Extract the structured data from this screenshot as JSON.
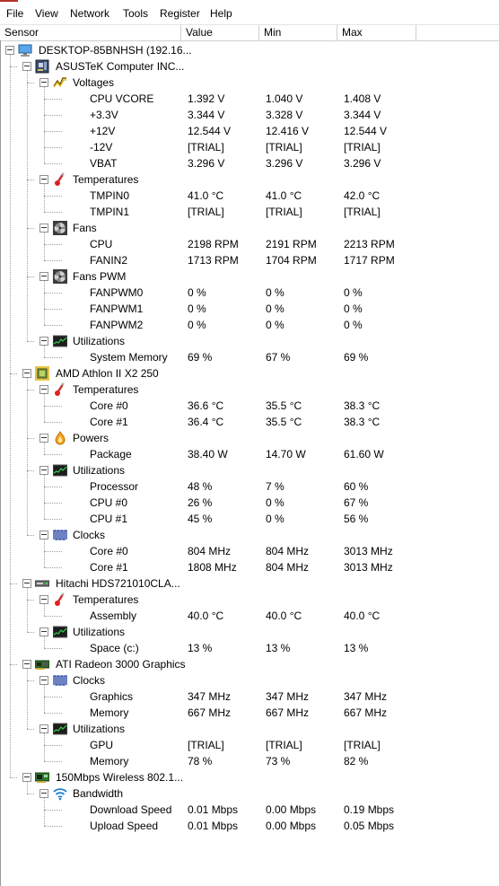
{
  "menu": [
    "File",
    "View",
    "Network",
    "Tools",
    "Register",
    "Help"
  ],
  "columns": {
    "sensor": "Sensor",
    "value": "Value",
    "min": "Min",
    "max": "Max"
  },
  "rows": [
    {
      "level": 0,
      "type": "computer",
      "label": "DESKTOP-85BNHSH (192.16...",
      "icon": "computer-icon"
    },
    {
      "level": 1,
      "type": "board",
      "label": "ASUSTeK Computer INC...",
      "icon": "motherboard-icon"
    },
    {
      "level": 2,
      "type": "group",
      "label": "Voltages",
      "icon": "voltage-icon"
    },
    {
      "level": 3,
      "label": "CPU VCORE",
      "value": "1.392 V",
      "min": "1.040 V",
      "max": "1.408 V"
    },
    {
      "level": 3,
      "label": "+3.3V",
      "value": "3.344 V",
      "min": "3.328 V",
      "max": "3.344 V"
    },
    {
      "level": 3,
      "label": "+12V",
      "value": "12.544 V",
      "min": "12.416 V",
      "max": "12.544 V"
    },
    {
      "level": 3,
      "label": "-12V",
      "value": "[TRIAL]",
      "min": "[TRIAL]",
      "max": "[TRIAL]"
    },
    {
      "level": 3,
      "label": "VBAT",
      "value": "3.296 V",
      "min": "3.296 V",
      "max": "3.296 V",
      "last": true
    },
    {
      "level": 2,
      "type": "group",
      "label": "Temperatures",
      "icon": "thermometer-icon"
    },
    {
      "level": 3,
      "label": "TMPIN0",
      "value": "41.0 °C",
      "min": "41.0 °C",
      "max": "42.0 °C"
    },
    {
      "level": 3,
      "label": "TMPIN1",
      "value": "[TRIAL]",
      "min": "[TRIAL]",
      "max": "[TRIAL]",
      "last": true
    },
    {
      "level": 2,
      "type": "group",
      "label": "Fans",
      "icon": "fan-icon"
    },
    {
      "level": 3,
      "label": "CPU",
      "value": "2198 RPM",
      "min": "2191 RPM",
      "max": "2213 RPM"
    },
    {
      "level": 3,
      "label": "FANIN2",
      "value": "1713 RPM",
      "min": "1704 RPM",
      "max": "1717 RPM",
      "last": true
    },
    {
      "level": 2,
      "type": "group",
      "label": "Fans PWM",
      "icon": "fan-icon"
    },
    {
      "level": 3,
      "label": "FANPWM0",
      "value": "0 %",
      "min": "0 %",
      "max": "0 %"
    },
    {
      "level": 3,
      "label": "FANPWM1",
      "value": "0 %",
      "min": "0 %",
      "max": "0 %"
    },
    {
      "level": 3,
      "label": "FANPWM2",
      "value": "0 %",
      "min": "0 %",
      "max": "0 %",
      "last": true
    },
    {
      "level": 2,
      "type": "group",
      "label": "Utilizations",
      "icon": "utilization-icon",
      "lastgroup": true
    },
    {
      "level": 3,
      "label": "System Memory",
      "value": "69 %",
      "min": "67 %",
      "max": "69 %",
      "last": true
    },
    {
      "level": 1,
      "type": "chip",
      "label": "AMD Athlon II X2 250",
      "icon": "cpu-chip-icon"
    },
    {
      "level": 2,
      "type": "group",
      "label": "Temperatures",
      "icon": "thermometer-icon"
    },
    {
      "level": 3,
      "label": "Core #0",
      "value": "36.6 °C",
      "min": "35.5 °C",
      "max": "38.3 °C"
    },
    {
      "level": 3,
      "label": "Core #1",
      "value": "36.4 °C",
      "min": "35.5 °C",
      "max": "38.3 °C",
      "last": true
    },
    {
      "level": 2,
      "type": "group",
      "label": "Powers",
      "icon": "power-icon"
    },
    {
      "level": 3,
      "label": "Package",
      "value": "38.40 W",
      "min": "14.70 W",
      "max": "61.60 W",
      "last": true
    },
    {
      "level": 2,
      "type": "group",
      "label": "Utilizations",
      "icon": "utilization-icon"
    },
    {
      "level": 3,
      "label": "Processor",
      "value": "48 %",
      "min": "7 %",
      "max": "60 %"
    },
    {
      "level": 3,
      "label": "CPU #0",
      "value": "26 %",
      "min": "0 %",
      "max": "67 %"
    },
    {
      "level": 3,
      "label": "CPU #1",
      "value": "45 %",
      "min": "0 %",
      "max": "56 %",
      "last": true
    },
    {
      "level": 2,
      "type": "group",
      "label": "Clocks",
      "icon": "clock-icon",
      "lastgroup": true
    },
    {
      "level": 3,
      "label": "Core #0",
      "value": "804 MHz",
      "min": "804 MHz",
      "max": "3013 MHz"
    },
    {
      "level": 3,
      "label": "Core #1",
      "value": "1808 MHz",
      "min": "804 MHz",
      "max": "3013 MHz",
      "last": true
    },
    {
      "level": 1,
      "type": "disk",
      "label": "Hitachi HDS721010CLA...",
      "icon": "hard-disk-icon"
    },
    {
      "level": 2,
      "type": "group",
      "label": "Temperatures",
      "icon": "thermometer-icon"
    },
    {
      "level": 3,
      "label": "Assembly",
      "value": "40.0 °C",
      "min": "40.0 °C",
      "max": "40.0 °C",
      "last": true
    },
    {
      "level": 2,
      "type": "group",
      "label": "Utilizations",
      "icon": "utilization-icon",
      "lastgroup": true
    },
    {
      "level": 3,
      "label": "Space (c:)",
      "value": "13 %",
      "min": "13 %",
      "max": "13 %",
      "last": true
    },
    {
      "level": 1,
      "type": "gpu",
      "label": "ATI Radeon 3000 Graphics",
      "icon": "graphics-card-icon"
    },
    {
      "level": 2,
      "type": "group",
      "label": "Clocks",
      "icon": "clock-icon"
    },
    {
      "level": 3,
      "label": "Graphics",
      "value": "347 MHz",
      "min": "347 MHz",
      "max": "347 MHz"
    },
    {
      "level": 3,
      "label": "Memory",
      "value": "667 MHz",
      "min": "667 MHz",
      "max": "667 MHz",
      "last": true
    },
    {
      "level": 2,
      "type": "group",
      "label": "Utilizations",
      "icon": "utilization-icon",
      "lastgroup": true
    },
    {
      "level": 3,
      "label": "GPU",
      "value": "[TRIAL]",
      "min": "[TRIAL]",
      "max": "[TRIAL]"
    },
    {
      "level": 3,
      "label": "Memory",
      "value": "78 %",
      "min": "73 %",
      "max": "82 %",
      "last": true
    },
    {
      "level": 1,
      "type": "nic",
      "label": "150Mbps Wireless 802.1...",
      "icon": "network-card-icon"
    },
    {
      "level": 2,
      "type": "group",
      "label": "Bandwidth",
      "icon": "wifi-icon",
      "lastgroup": true
    },
    {
      "level": 3,
      "label": "Download Speed",
      "value": "0.01 Mbps",
      "min": "0.00 Mbps",
      "max": "0.19 Mbps"
    },
    {
      "level": 3,
      "label": "Upload Speed",
      "value": "0.01 Mbps",
      "min": "0.00 Mbps",
      "max": "0.05 Mbps",
      "last": true
    }
  ]
}
